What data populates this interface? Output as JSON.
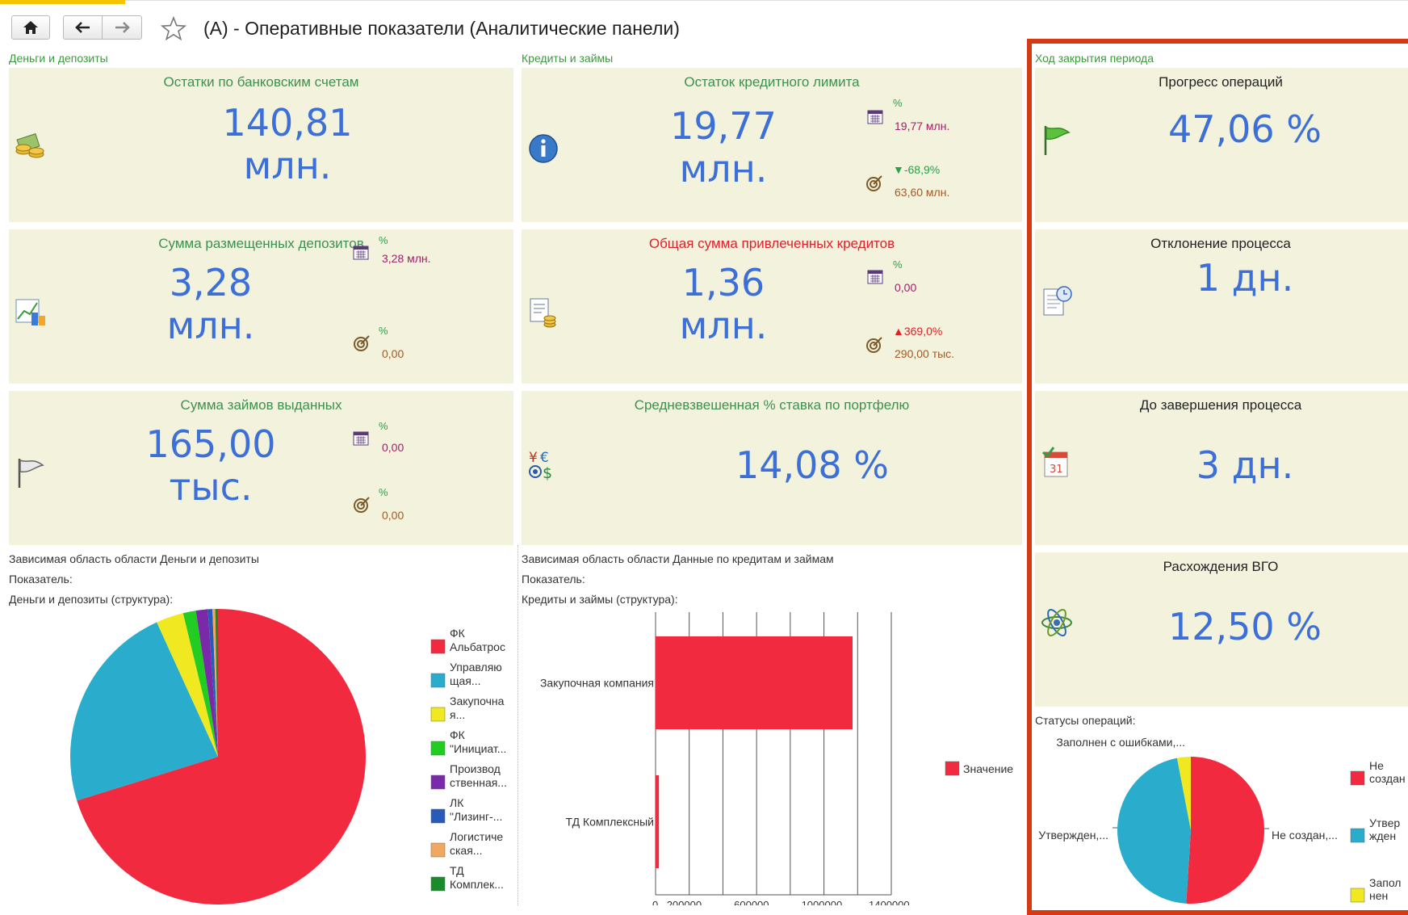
{
  "window": {
    "title": "(А) - Оперативные показатели (Аналитические панели)"
  },
  "groups": {
    "money": "Деньги и депозиты",
    "credits": "Кредиты и займы",
    "closing": "Ход закрытия периода"
  },
  "money": {
    "bank_title": "Остатки по банковским счетам",
    "bank_value": "140,81",
    "bank_unit": "млн.",
    "deposits_title": "Сумма размещенных депозитов",
    "deposits_value": "3,28",
    "deposits_unit": "млн.",
    "deposits_plan_pct": "%",
    "deposits_plan_val": "3,28 млн.",
    "deposits_target_pct": "%",
    "deposits_target_val": "0,00",
    "loans_title": "Сумма займов выданных",
    "loans_value": "165,00",
    "loans_unit": "тыс.",
    "loans_plan_pct": "%",
    "loans_plan_val": "0,00",
    "loans_target_pct": "%",
    "loans_target_val": "0,00"
  },
  "credits": {
    "limit_title": "Остаток кредитного лимита",
    "limit_value": "19,77",
    "limit_unit": "млн.",
    "limit_plan_pct": "%",
    "limit_plan_val": "19,77 млн.",
    "limit_target_pct": "▼-68,9%",
    "limit_target_val": "63,60 млн.",
    "total_title": "Общая сумма привлеченных кредитов",
    "total_value": "1,36",
    "total_unit": "млн.",
    "total_plan_pct": "%",
    "total_plan_val": "0,00",
    "total_target_pct": "▲369,0%",
    "total_target_val": "290,00 тыс.",
    "rate_title": "Средневзвешенная % ставка по портфелю",
    "rate_value": "14,08 %"
  },
  "closing": {
    "progress_title": "Прогресс операций",
    "progress_value": "47,06 %",
    "deviation_title": "Отклонение процесса",
    "deviation_value": "1 дн.",
    "remaining_title": "До завершения процесса",
    "remaining_value": "3 дн.",
    "vgo_title": "Расхождения ВГО",
    "vgo_value": "12,50 %",
    "statuses_label": "Статусы операций:"
  },
  "money_detail": {
    "header": "Зависимая область области Деньги и депозиты",
    "indicator": "Показатель:",
    "structure": "Деньги и депозиты (структура):"
  },
  "credits_detail": {
    "header": "Зависимая область области Данные по кредитам и займам",
    "indicator": "Показатель:",
    "structure": "Кредиты и займы (структура):"
  },
  "icons": {
    "home": "home-icon",
    "back": "arrow-left-icon",
    "forward": "arrow-right-icon",
    "favorite": "star-icon",
    "calendar": "calendar-icon",
    "target": "target-icon",
    "coins": "coins-icon",
    "info": "info-icon",
    "flag": "flag-icon",
    "currency": "currency-icon",
    "document": "document-icon",
    "atom": "atom-icon"
  },
  "colors": {
    "panel_bg": "#f3f2dc",
    "big_value": "#3d6fd8",
    "panel_title": "#3f8f52",
    "frame": "#d63a12"
  },
  "chart_data": [
    {
      "type": "pie",
      "legend_placement": "right",
      "slices": [
        {
          "label": "ФК Альбатрос",
          "value": 70.2,
          "color": "#f22a40"
        },
        {
          "label": "Управляю щая...",
          "value": 23.0,
          "color": "#2aaccc"
        },
        {
          "label": "Закупочна я...",
          "value": 3.0,
          "color": "#f0e820"
        },
        {
          "label": "ФК \"Инициат...",
          "value": 1.4,
          "color": "#22cc22"
        },
        {
          "label": "Производ ственная...",
          "value": 1.3,
          "color": "#7a2aa8"
        },
        {
          "label": "ЛК \"Лизинг-...",
          "value": 0.5,
          "color": "#2a5ab8"
        },
        {
          "label": "Логистиче ская...",
          "value": 0.3,
          "color": "#f0a860"
        },
        {
          "label": "ТД Комплек...",
          "value": 0.3,
          "color": "#1a8a2a"
        }
      ]
    },
    {
      "type": "bar",
      "orientation": "horizontal",
      "categories": [
        "Закупочная компания",
        "ТД Комплексный"
      ],
      "series": [
        {
          "name": "Значение",
          "values": [
            1170000,
            20000
          ],
          "color": "#f22a40"
        }
      ],
      "xlim": [
        0,
        1400000
      ],
      "xticks": [
        "0",
        "200000",
        "600000",
        "1000000",
        "1400000"
      ],
      "grid": true,
      "legend_placement": "right"
    },
    {
      "type": "pie",
      "slices": [
        {
          "label": "Не создан,...",
          "legend": "Не создан",
          "value": 51,
          "color": "#f22a40"
        },
        {
          "label": "Утвержден,...",
          "legend": "Утвер жден",
          "value": 46,
          "color": "#2aaccc"
        },
        {
          "label": "Заполнен с ошибками,...",
          "legend": "Запол нен с ошибк",
          "value": 3,
          "color": "#f0e820"
        }
      ]
    }
  ]
}
